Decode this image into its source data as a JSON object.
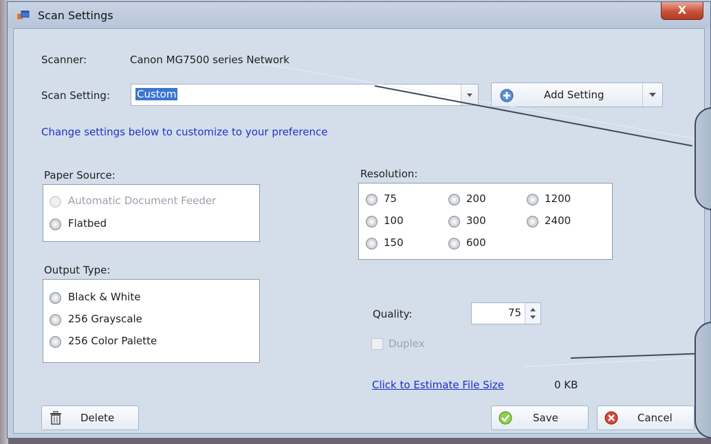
{
  "window": {
    "title": "Scan Settings",
    "close_glyph": "X"
  },
  "scanner": {
    "label": "Scanner:",
    "value": "Canon MG7500 series Network"
  },
  "scan_setting": {
    "label": "Scan Setting:",
    "value": "Custom",
    "add_label": "Add Setting"
  },
  "hint": "Change settings below to customize to your preference",
  "paper_source": {
    "label": "Paper Source:",
    "options": [
      "Automatic Document Feeder",
      "Flatbed"
    ]
  },
  "output_type": {
    "label": "Output Type:",
    "options": [
      "Black & White",
      "256 Grayscale",
      "256 Color Palette"
    ]
  },
  "resolution": {
    "label": "Resolution:",
    "options": [
      "75",
      "100",
      "150",
      "200",
      "300",
      "600",
      "1200",
      "2400"
    ]
  },
  "quality": {
    "label": "Quality:",
    "value": "75"
  },
  "duplex": {
    "label": "Duplex"
  },
  "estimate": {
    "link": "Click to Estimate File Size",
    "size": "0 KB"
  },
  "buttons": {
    "delete": "Delete",
    "save": "Save",
    "cancel": "Cancel"
  },
  "icons": [
    "app-window-icon",
    "plus-circle-icon",
    "trash-icon",
    "check-circle-icon",
    "cancel-x-icon"
  ],
  "colors": {
    "link_blue": "#1f34c8",
    "window_bg": "#d4deeb",
    "accent_green": "#6abf2a",
    "cancel_red": "#d03a2a"
  }
}
